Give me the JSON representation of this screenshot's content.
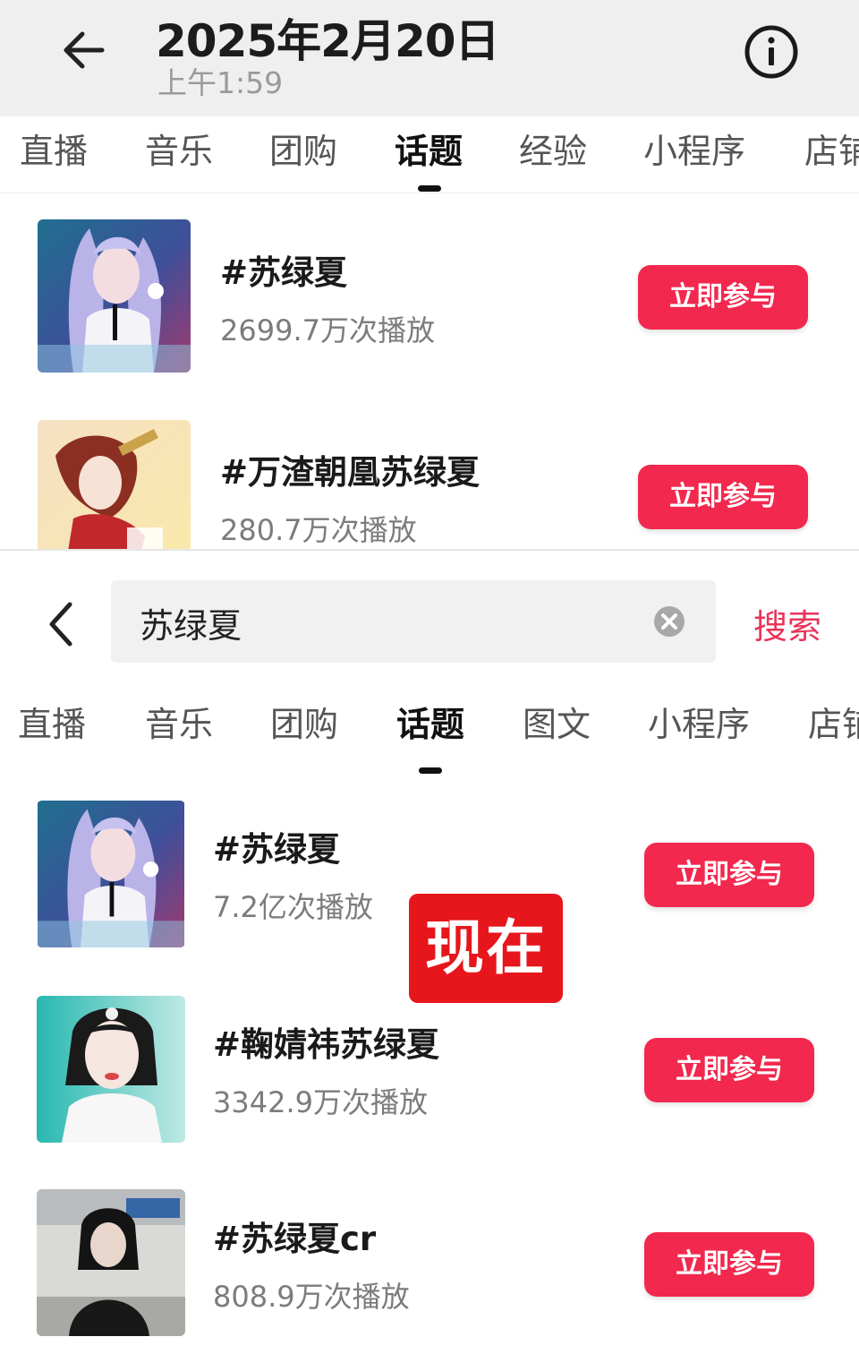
{
  "top": {
    "header": {
      "date": "2025年2月20日",
      "time": "上午1:59",
      "back_icon": "arrow-left-icon",
      "info_icon": "info-circle-icon"
    },
    "tabs": [
      {
        "label": "直播"
      },
      {
        "label": "音乐"
      },
      {
        "label": "团购"
      },
      {
        "label": "话题",
        "active": true
      },
      {
        "label": "经验"
      },
      {
        "label": "小程序"
      },
      {
        "label": "店铺"
      }
    ],
    "rows": [
      {
        "title": "#苏绿夏",
        "views": "2699.7万次播放",
        "button": "立即参与"
      },
      {
        "title": "#万渣朝凰苏绿夏",
        "views": "280.7万次播放",
        "button": "立即参与"
      }
    ]
  },
  "bottom": {
    "search": {
      "back_icon": "chevron-left-icon",
      "query": "苏绿夏",
      "clear_icon": "clear-circle-icon",
      "button": "搜索"
    },
    "tabs": [
      {
        "label": "直播"
      },
      {
        "label": "音乐"
      },
      {
        "label": "团购"
      },
      {
        "label": "话题",
        "active": true
      },
      {
        "label": "图文"
      },
      {
        "label": "小程序"
      },
      {
        "label": "店铺"
      }
    ],
    "rows": [
      {
        "title": "#苏绿夏",
        "views": "7.2亿次播放",
        "button": "立即参与"
      },
      {
        "title": "#鞠婧祎苏绿夏",
        "views": "3342.9万次播放",
        "button": "立即参与"
      },
      {
        "title": "#苏绿夏cr",
        "views": "808.9万次播放",
        "button": "立即参与"
      }
    ]
  },
  "overlay": {
    "badge": "现在"
  },
  "colors": {
    "accent": "#f2284e",
    "badge": "#e6161c",
    "search_button": "#e8345a"
  }
}
